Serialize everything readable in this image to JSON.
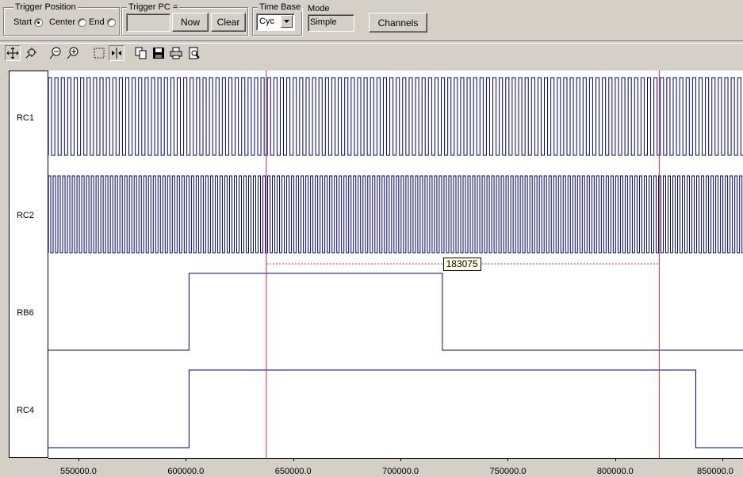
{
  "toolbar": {
    "trigger_position": {
      "label": "Trigger Position",
      "options": [
        {
          "label": "Start",
          "selected": true
        },
        {
          "label": "Center",
          "selected": false
        },
        {
          "label": "End",
          "selected": false
        }
      ]
    },
    "trigger_pc": {
      "label": "Trigger PC =",
      "value": "",
      "now_label": "Now",
      "clear_label": "Clear"
    },
    "time_base": {
      "label": "Time Base",
      "value": "Cyc"
    },
    "mode": {
      "label": "Mode",
      "value": "Simple"
    },
    "channels_label": "Channels"
  },
  "icon_toolbar": [
    "move-icon",
    "zoom-fit-icon",
    "zoom-out-icon",
    "zoom-in-icon",
    "select-region-icon",
    "cursor-marker-icon",
    "copy-icon",
    "save-icon",
    "print-icon",
    "print-preview-icon"
  ],
  "channels": [
    {
      "name": "RC1",
      "type": "clock",
      "period": 3000
    },
    {
      "name": "RC2",
      "type": "clock",
      "period": 2220
    },
    {
      "name": "RB6",
      "type": "digital",
      "transitions": [
        [
          540000,
          0
        ],
        [
          601500,
          1
        ],
        [
          719500,
          0
        ]
      ]
    },
    {
      "name": "RC4",
      "type": "digital",
      "transitions": [
        [
          540000,
          0
        ],
        [
          601500,
          1
        ],
        [
          837500,
          0
        ]
      ]
    }
  ],
  "cursors": {
    "a": 637500,
    "b": 820500,
    "delta_label": "183075",
    "color": "#c83232"
  },
  "x_axis": {
    "range": [
      536000,
      859500
    ],
    "ticks": [
      "550000.0",
      "600000.0",
      "650000.0",
      "700000.0",
      "750000.0",
      "800000.0",
      "850000.0"
    ],
    "tick_values": [
      550000,
      600000,
      650000,
      700000,
      750000,
      800000,
      850000
    ]
  },
  "colors": {
    "signal": "#000080",
    "cursor": "#c83232",
    "background": "#ffffff",
    "panel": "#d4d0c8"
  }
}
